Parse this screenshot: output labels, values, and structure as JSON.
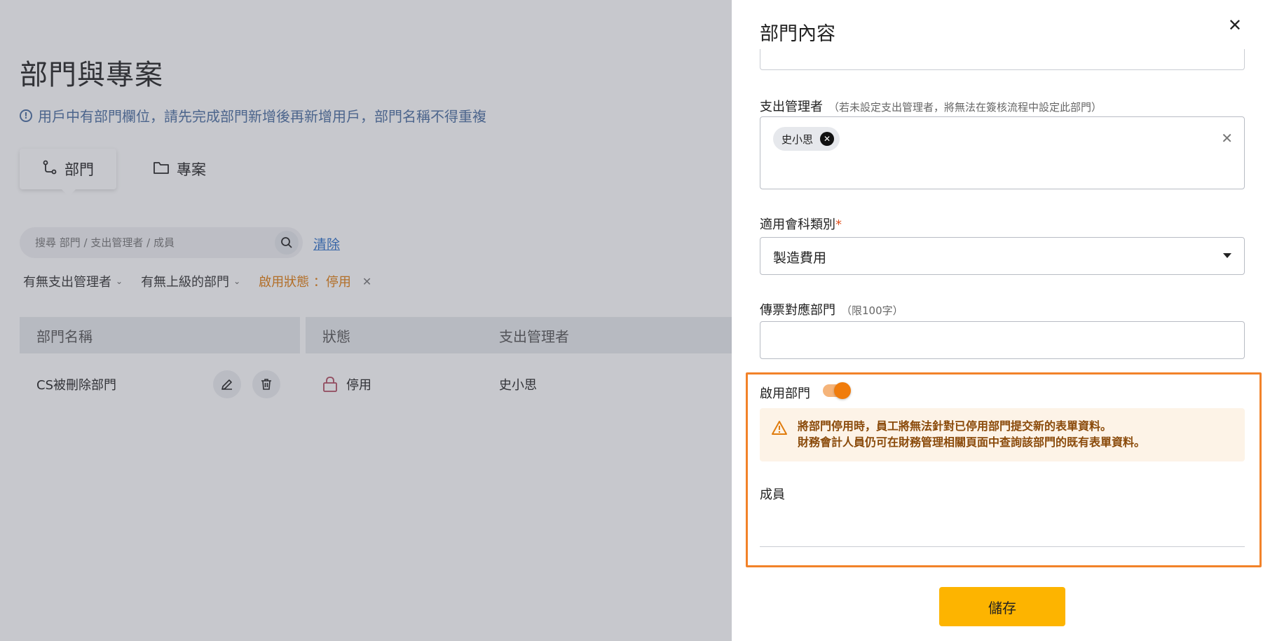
{
  "page": {
    "title": "部門與專案",
    "notice": "用戶中有部門欄位，請先完成部門新增後再新增用戶，部門名稱不得重複",
    "tabs": [
      {
        "label": "部門",
        "icon": "branch-icon"
      },
      {
        "label": "專案",
        "icon": "folder-icon"
      }
    ],
    "search": {
      "placeholder": "搜尋 部門 / 支出管理者 / 成員",
      "clear_label": "清除"
    },
    "filters": [
      {
        "label": "有無支出管理者"
      },
      {
        "label": "有無上級的部門"
      },
      {
        "label": "啟用狀態 ：停用",
        "active": true
      }
    ],
    "table": {
      "headers": [
        "部門名稱",
        "狀態",
        "支出管理者"
      ],
      "rows": [
        {
          "name": "CS被刪除部門",
          "status": "停用",
          "manager": "史小思"
        }
      ]
    }
  },
  "drawer": {
    "title": "部門內容",
    "expense_manager": {
      "label": "支出管理者",
      "hint": "（若未設定支出管理者，將無法在簽核流程中設定此部門）",
      "chips": [
        "史小思"
      ]
    },
    "account_category": {
      "label": "適用會科類別",
      "required_mark": "*",
      "value": "製造費用"
    },
    "voucher_department": {
      "label": "傳票對應部門",
      "hint": "（限100字）",
      "value": ""
    },
    "enable_department": {
      "label": "啟用部門",
      "enabled": true
    },
    "warning": {
      "line1": "將部門停用時，員工將無法針對已停用部門提交新的表單資料。",
      "line2": "財務會計人員仍可在財務管理相關頁面中查詢該部門的既有表單資料。"
    },
    "members": {
      "label": "成員"
    },
    "save_label": "儲存"
  },
  "colors": {
    "accent": "#f07c0c",
    "save_button": "#fdb400",
    "highlight_border": "#f28229",
    "link": "#2d6fc8"
  }
}
